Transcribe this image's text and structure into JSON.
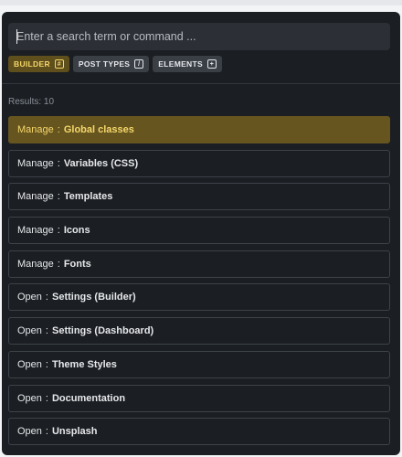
{
  "search": {
    "placeholder": "Enter a search term or command ..."
  },
  "filters": [
    {
      "label": "BUILDER",
      "key": "#",
      "active": true
    },
    {
      "label": "POST TYPES",
      "key": "/",
      "active": false
    },
    {
      "label": "ELEMENTS",
      "key": "+",
      "active": false
    }
  ],
  "results_label": "Results: 10",
  "results": [
    {
      "command": "Manage",
      "separator": ":",
      "target": "Global classes"
    },
    {
      "command": "Manage",
      "separator": ":",
      "target": "Variables (CSS)"
    },
    {
      "command": "Manage",
      "separator": ":",
      "target": "Templates"
    },
    {
      "command": "Manage",
      "separator": ":",
      "target": "Icons"
    },
    {
      "command": "Manage",
      "separator": ":",
      "target": "Fonts"
    },
    {
      "command": "Open",
      "separator": ":",
      "target": "Settings (Builder)"
    },
    {
      "command": "Open",
      "separator": ":",
      "target": "Settings (Dashboard)"
    },
    {
      "command": "Open",
      "separator": ":",
      "target": "Theme Styles"
    },
    {
      "command": "Open",
      "separator": ":",
      "target": "Documentation"
    },
    {
      "command": "Open",
      "separator": ":",
      "target": "Unsplash"
    }
  ],
  "colors": {
    "background": "#1b1e22",
    "accent": "#f5d66b",
    "accent_bg": "#66551f"
  }
}
